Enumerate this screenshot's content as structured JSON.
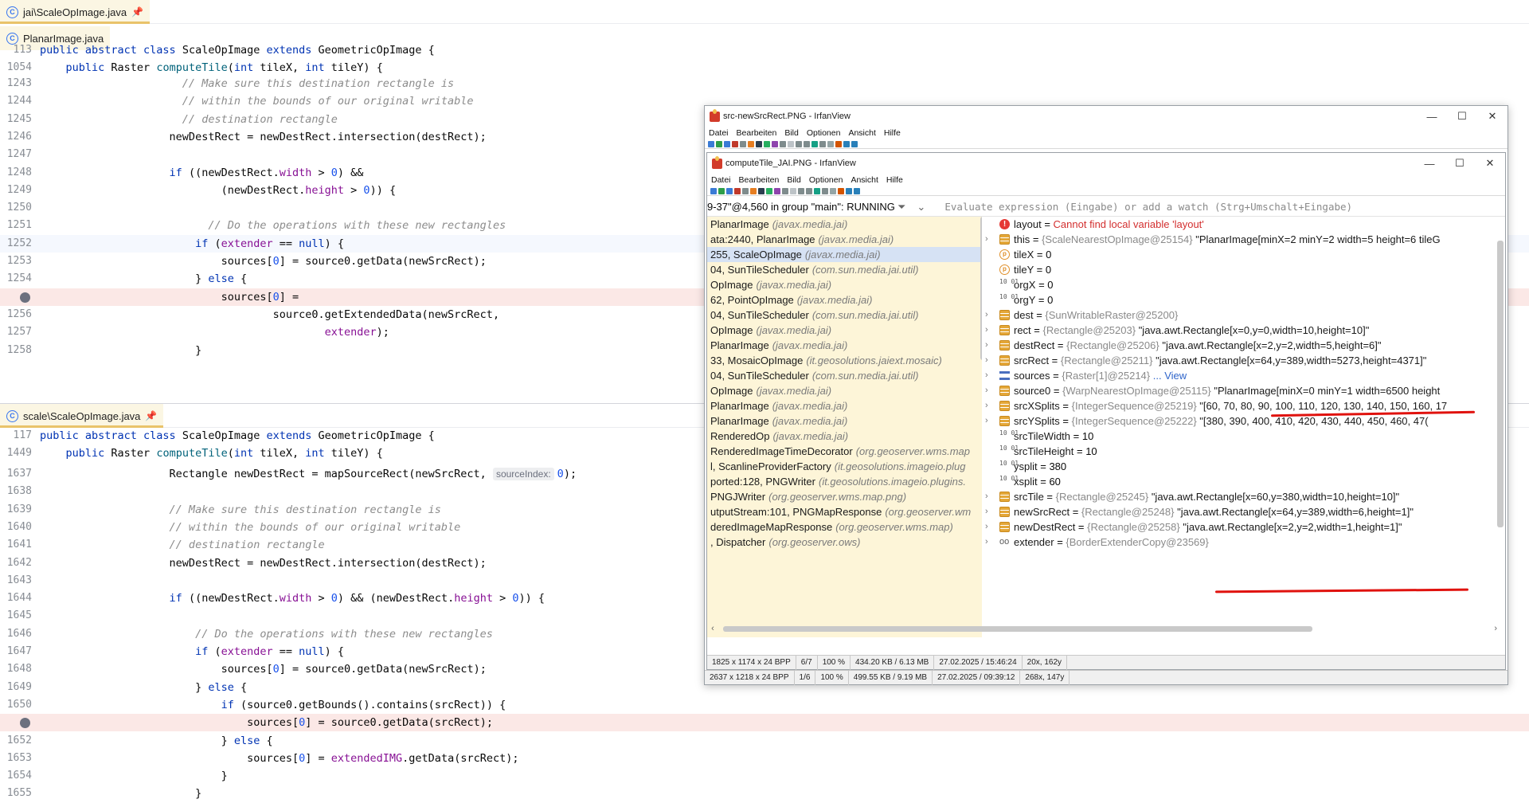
{
  "editor_top": {
    "tab_label": "jai\\ScaleOpImage.java",
    "subtab_label": "PlanarImage.java",
    "sticky": [
      {
        "num": "113",
        "tokens": [
          [
            "kw",
            "public abstract class "
          ],
          [
            "pl",
            "ScaleOpImage "
          ],
          [
            "kw",
            "extends "
          ],
          [
            "pl",
            "GeometricOpImage {"
          ]
        ]
      },
      {
        "num": "1054",
        "tokens": [
          [
            "kw",
            "    public "
          ],
          [
            "pl",
            "Raster "
          ],
          [
            "fn",
            "computeTile"
          ],
          [
            "pl",
            "("
          ],
          [
            "kw",
            "int "
          ],
          [
            "pl",
            "tileX, "
          ],
          [
            "kw",
            "int "
          ],
          [
            "pl",
            "tileY) {"
          ]
        ]
      }
    ],
    "lines": [
      {
        "num": "1243",
        "tokens": [
          [
            "cm",
            "                      // Make sure this destination rectangle is"
          ]
        ]
      },
      {
        "num": "1244",
        "tokens": [
          [
            "cm",
            "                      // within the bounds of our original writable"
          ]
        ]
      },
      {
        "num": "1245",
        "tokens": [
          [
            "cm",
            "                      // destination rectangle"
          ]
        ]
      },
      {
        "num": "1246",
        "tokens": [
          [
            "pl",
            "                    newDestRect = newDestRect.intersection(destRect);"
          ]
        ]
      },
      {
        "num": "1247",
        "tokens": []
      },
      {
        "num": "1248",
        "tokens": [
          [
            "kw",
            "                    if "
          ],
          [
            "pl",
            "((newDestRect."
          ],
          [
            "fd",
            "width"
          ],
          [
            "pl",
            " > "
          ],
          [
            "nm",
            "0"
          ],
          [
            "pl",
            ") &&"
          ]
        ]
      },
      {
        "num": "1249",
        "tokens": [
          [
            "pl",
            "                            (newDestRect."
          ],
          [
            "fd",
            "height"
          ],
          [
            "pl",
            " > "
          ],
          [
            "nm",
            "0"
          ],
          [
            "pl",
            ")) {"
          ]
        ]
      },
      {
        "num": "1250",
        "tokens": []
      },
      {
        "num": "1251",
        "tokens": [
          [
            "cm",
            "                          // Do the operations with these new rectangles"
          ]
        ]
      },
      {
        "num": "1252",
        "tokens": [
          [
            "kw",
            "                        if "
          ],
          [
            "pl",
            "("
          ],
          [
            "fd",
            "extender"
          ],
          [
            "pl",
            " == "
          ],
          [
            "kw",
            "null"
          ],
          [
            "pl",
            ") {"
          ]
        ],
        "cls": "hl-cur"
      },
      {
        "num": "1253",
        "tokens": [
          [
            "pl",
            "                            sources["
          ],
          [
            "nm",
            "0"
          ],
          [
            "pl",
            "] = source0.getData(newSrcRect);"
          ]
        ]
      },
      {
        "num": "1254",
        "tokens": [
          [
            "pl",
            "                        } "
          ],
          [
            "kw",
            "else "
          ],
          [
            "pl",
            "{"
          ]
        ]
      },
      {
        "num": "",
        "tokens": [
          [
            "pl",
            "                            sources["
          ],
          [
            "nm",
            "0"
          ],
          [
            "pl",
            "] ="
          ]
        ],
        "cls": "hl-bp",
        "bp": true
      },
      {
        "num": "1256",
        "tokens": [
          [
            "pl",
            "                                    source0.getExtendedData(newSrcRect,"
          ]
        ]
      },
      {
        "num": "1257",
        "tokens": [
          [
            "fd",
            "                                            extender"
          ],
          [
            "pl",
            ");"
          ]
        ]
      },
      {
        "num": "1258",
        "tokens": [
          [
            "pl",
            "                        }"
          ]
        ]
      }
    ]
  },
  "editor_bottom": {
    "tab_label": "scale\\ScaleOpImage.java",
    "sticky": [
      {
        "num": "117",
        "tokens": [
          [
            "kw",
            "public abstract class "
          ],
          [
            "pl",
            "ScaleOpImage "
          ],
          [
            "kw",
            "extends "
          ],
          [
            "pl",
            "GeometricOpImage {"
          ]
        ]
      },
      {
        "num": "1449",
        "tokens": [
          [
            "kw",
            "    public "
          ],
          [
            "pl",
            "Raster "
          ],
          [
            "fn",
            "computeTile"
          ],
          [
            "pl",
            "("
          ],
          [
            "kw",
            "int "
          ],
          [
            "pl",
            "tileX, "
          ],
          [
            "kw",
            "int "
          ],
          [
            "pl",
            "tileY) {"
          ]
        ]
      }
    ],
    "lines": [
      {
        "num": "1637",
        "tokens": [
          [
            "pl",
            "                    Rectangle newDestRect = mapSourceRect(newSrcRect, "
          ],
          [
            "hint",
            "sourceIndex:"
          ],
          [
            "nm",
            "0"
          ],
          [
            "pl",
            ");"
          ]
        ]
      },
      {
        "num": "1638",
        "tokens": []
      },
      {
        "num": "1639",
        "tokens": [
          [
            "cm",
            "                    // Make sure this destination rectangle is"
          ]
        ]
      },
      {
        "num": "1640",
        "tokens": [
          [
            "cm",
            "                    // within the bounds of our original writable"
          ]
        ]
      },
      {
        "num": "1641",
        "tokens": [
          [
            "cm",
            "                    // destination rectangle"
          ]
        ]
      },
      {
        "num": "1642",
        "tokens": [
          [
            "pl",
            "                    newDestRect = newDestRect.intersection(destRect);"
          ]
        ]
      },
      {
        "num": "1643",
        "tokens": []
      },
      {
        "num": "1644",
        "tokens": [
          [
            "kw",
            "                    if "
          ],
          [
            "pl",
            "((newDestRect."
          ],
          [
            "fd",
            "width"
          ],
          [
            "pl",
            " > "
          ],
          [
            "nm",
            "0"
          ],
          [
            "pl",
            ") && (newDestRect."
          ],
          [
            "fd",
            "height"
          ],
          [
            "pl",
            " > "
          ],
          [
            "nm",
            "0"
          ],
          [
            "pl",
            ")) {"
          ]
        ]
      },
      {
        "num": "1645",
        "tokens": []
      },
      {
        "num": "1646",
        "tokens": [
          [
            "cm",
            "                        // Do the operations with these new rectangles"
          ]
        ]
      },
      {
        "num": "1647",
        "tokens": [
          [
            "kw",
            "                        if "
          ],
          [
            "pl",
            "("
          ],
          [
            "fd",
            "extender"
          ],
          [
            "pl",
            " == "
          ],
          [
            "kw",
            "null"
          ],
          [
            "pl",
            ") {"
          ]
        ]
      },
      {
        "num": "1648",
        "tokens": [
          [
            "pl",
            "                            sources["
          ],
          [
            "nm",
            "0"
          ],
          [
            "pl",
            "] = source0.getData(newSrcRect);"
          ]
        ]
      },
      {
        "num": "1649",
        "tokens": [
          [
            "pl",
            "                        } "
          ],
          [
            "kw",
            "else "
          ],
          [
            "pl",
            "{"
          ]
        ]
      },
      {
        "num": "1650",
        "tokens": [
          [
            "kw",
            "                            if "
          ],
          [
            "pl",
            "(source0.getBounds().contains(srcRect)) {"
          ]
        ]
      },
      {
        "num": "",
        "tokens": [
          [
            "pl",
            "                                sources["
          ],
          [
            "nm",
            "0"
          ],
          [
            "pl",
            "] = source0.getData(srcRect);"
          ]
        ],
        "cls": "hl-bp",
        "bp": true
      },
      {
        "num": "1652",
        "tokens": [
          [
            "pl",
            "                            } "
          ],
          [
            "kw",
            "else "
          ],
          [
            "pl",
            "{"
          ]
        ]
      },
      {
        "num": "1653",
        "tokens": [
          [
            "pl",
            "                                sources["
          ],
          [
            "nm",
            "0"
          ],
          [
            "pl",
            "] = "
          ],
          [
            "fd",
            "extendedIMG"
          ],
          [
            "pl",
            ".getData(srcRect);"
          ]
        ]
      },
      {
        "num": "1654",
        "tokens": [
          [
            "pl",
            "                            }"
          ]
        ]
      },
      {
        "num": "1655",
        "tokens": [
          [
            "pl",
            "                        }"
          ]
        ]
      }
    ]
  },
  "irfan_outer": {
    "title": "src-newSrcRect.PNG - IrfanView",
    "menu": [
      "Datei",
      "Bearbeiten",
      "Bild",
      "Optionen",
      "Ansicht",
      "Hilfe"
    ],
    "status": [
      "2637 x 1218 x 24 BPP",
      "1/6",
      "100 %",
      "499.55 KB / 9.19 MB",
      "27.02.2025 / 09:39:12",
      "268x, 147y"
    ]
  },
  "irfan_inner": {
    "title": "computeTile_JAI.PNG - IrfanView",
    "menu": [
      "Datei",
      "Bearbeiten",
      "Bild",
      "Optionen",
      "Ansicht",
      "Hilfe"
    ],
    "status": [
      "1825 x 1174 x 24 BPP",
      "6/7",
      "100 %",
      "434.20 KB / 6.13 MB",
      "27.02.2025 / 15:46:24",
      "20x, 162y"
    ]
  },
  "debugger": {
    "thread": "9-37\"@4,560 in group \"main\": RUNNING",
    "expr_placeholder": "Evaluate expression (Eingabe) or add a watch (Strg+Umschalt+Eingabe)",
    "frames": [
      {
        "m": "PlanarImage",
        "p": "(javax.media.jai)"
      },
      {
        "m": "ata:2440, PlanarImage",
        "p": "(javax.media.jai)"
      },
      {
        "m": "255, ScaleOpImage",
        "p": "(javax.media.jai)",
        "sel": true
      },
      {
        "m": "04, SunTileScheduler",
        "p": "(com.sun.media.jai.util)"
      },
      {
        "m": "OpImage",
        "p": "(javax.media.jai)"
      },
      {
        "m": "62, PointOpImage",
        "p": "(javax.media.jai)"
      },
      {
        "m": "04, SunTileScheduler",
        "p": "(com.sun.media.jai.util)"
      },
      {
        "m": "OpImage",
        "p": "(javax.media.jai)"
      },
      {
        "m": " PlanarImage",
        "p": "(javax.media.jai)"
      },
      {
        "m": "33, MosaicOpImage",
        "p": "(it.geosolutions.jaiext.mosaic)"
      },
      {
        "m": "04, SunTileScheduler",
        "p": "(com.sun.media.jai.util)"
      },
      {
        "m": "OpImage",
        "p": "(javax.media.jai)"
      },
      {
        "m": " PlanarImage",
        "p": "(javax.media.jai)"
      },
      {
        "m": " PlanarImage",
        "p": "(javax.media.jai)"
      },
      {
        "m": " RenderedOp",
        "p": "(javax.media.jai)"
      },
      {
        "m": "RenderedImageTimeDecorator",
        "p": "(org.geoserver.wms.map"
      },
      {
        "m": "l, ScanlineProviderFactory",
        "p": "(it.geosolutions.imageio.plug"
      },
      {
        "m": "ported:128, PNGWriter",
        "p": "(it.geosolutions.imageio.plugins."
      },
      {
        "m": "PNGJWriter",
        "p": "(org.geoserver.wms.map.png)"
      },
      {
        "m": "utputStream:101, PNGMapResponse",
        "p": "(org.geoserver.wm"
      },
      {
        "m": "deredImageMapResponse",
        "p": "(org.geoserver.wms.map)"
      },
      {
        "m": ", Dispatcher",
        "p": "(org.geoserver.ows)"
      }
    ],
    "vars": [
      {
        "icon": "e",
        "exp": false,
        "name": "layout",
        "eq": " = ",
        "err": "Cannot find local variable 'layout'"
      },
      {
        "icon": "f",
        "exp": true,
        "name": "this",
        "eq": " = ",
        "type": "{ScaleNearestOpImage@25154}",
        "val": " \"PlanarImage[minX=2 minY=2 width=5 height=6 tileG"
      },
      {
        "icon": "p",
        "exp": false,
        "name": "tileX",
        "eq": " = ",
        "num": "0"
      },
      {
        "icon": "p",
        "exp": false,
        "name": "tileY",
        "eq": " = ",
        "num": "0"
      },
      {
        "icon": "b",
        "exp": false,
        "name": "orgX",
        "eq": " = ",
        "num": "0"
      },
      {
        "icon": "b",
        "exp": false,
        "name": "orgY",
        "eq": " = ",
        "num": "0"
      },
      {
        "icon": "f",
        "exp": true,
        "name": "dest",
        "eq": " = ",
        "type": "{SunWritableRaster@25200}"
      },
      {
        "icon": "f",
        "exp": true,
        "name": "rect",
        "eq": " = ",
        "type": "{Rectangle@25203}",
        "val": " \"java.awt.Rectangle[x=0,y=0,width=10,height=10]\""
      },
      {
        "icon": "f",
        "exp": true,
        "name": "destRect",
        "eq": " = ",
        "type": "{Rectangle@25206}",
        "val": " \"java.awt.Rectangle[x=2,y=2,width=5,height=6]\""
      },
      {
        "icon": "f",
        "exp": true,
        "name": "srcRect",
        "eq": " = ",
        "type": "{Rectangle@25211}",
        "val": " \"java.awt.Rectangle[x=64,y=389,width=5273,height=4371]\""
      },
      {
        "icon": "l",
        "exp": true,
        "name": "sources",
        "eq": " = ",
        "type": "{Raster[1]@25214}",
        "link": " ... View"
      },
      {
        "icon": "f",
        "exp": true,
        "name": "source0",
        "eq": " = ",
        "type": "{WarpNearestOpImage@25115}",
        "val": " \"PlanarImage[minX=0 minY=1 width=6500 height"
      },
      {
        "icon": "f",
        "exp": true,
        "name": "srcXSplits",
        "eq": " = ",
        "type": "{IntegerSequence@25219}",
        "val": " \"[60, 70, 80, 90, 100, 110, 120, 130, 140, 150, 160, 17"
      },
      {
        "icon": "f",
        "exp": true,
        "name": "srcYSplits",
        "eq": " = ",
        "type": "{IntegerSequence@25222}",
        "val": " \"[380, 390, 400, 410, 420, 430, 440, 450, 460, 47("
      },
      {
        "icon": "b",
        "exp": false,
        "name": "srcTileWidth",
        "eq": " = ",
        "num": "10"
      },
      {
        "icon": "b",
        "exp": false,
        "name": "srcTileHeight",
        "eq": " = ",
        "num": "10"
      },
      {
        "icon": "b",
        "exp": false,
        "name": "ysplit",
        "eq": " = ",
        "num": "380"
      },
      {
        "icon": "b",
        "exp": false,
        "name": "xsplit",
        "eq": " = ",
        "num": "60"
      },
      {
        "icon": "f",
        "exp": true,
        "name": "srcTile",
        "eq": " = ",
        "type": "{Rectangle@25245}",
        "val": " \"java.awt.Rectangle[x=60,y=380,width=10,height=10]\""
      },
      {
        "icon": "f",
        "exp": true,
        "name": "newSrcRect",
        "eq": " = ",
        "type": "{Rectangle@25248}",
        "val": " \"java.awt.Rectangle[x=64,y=389,width=6,height=1]\""
      },
      {
        "icon": "f",
        "exp": true,
        "name": "newDestRect",
        "eq": " = ",
        "type": "{Rectangle@25258}",
        "val": " \"java.awt.Rectangle[x=2,y=2,width=1,height=1]\""
      },
      {
        "icon": "w",
        "exp": true,
        "name": "extender",
        "eq": " = ",
        "type": "{BorderExtenderCopy@23569}"
      }
    ]
  },
  "colors": {
    "breakpoint_line": "#fbe8e6",
    "current_line": "#f5f8fe",
    "annotation_red": "#e0120e",
    "frames_bg": "#fdf5d8"
  }
}
